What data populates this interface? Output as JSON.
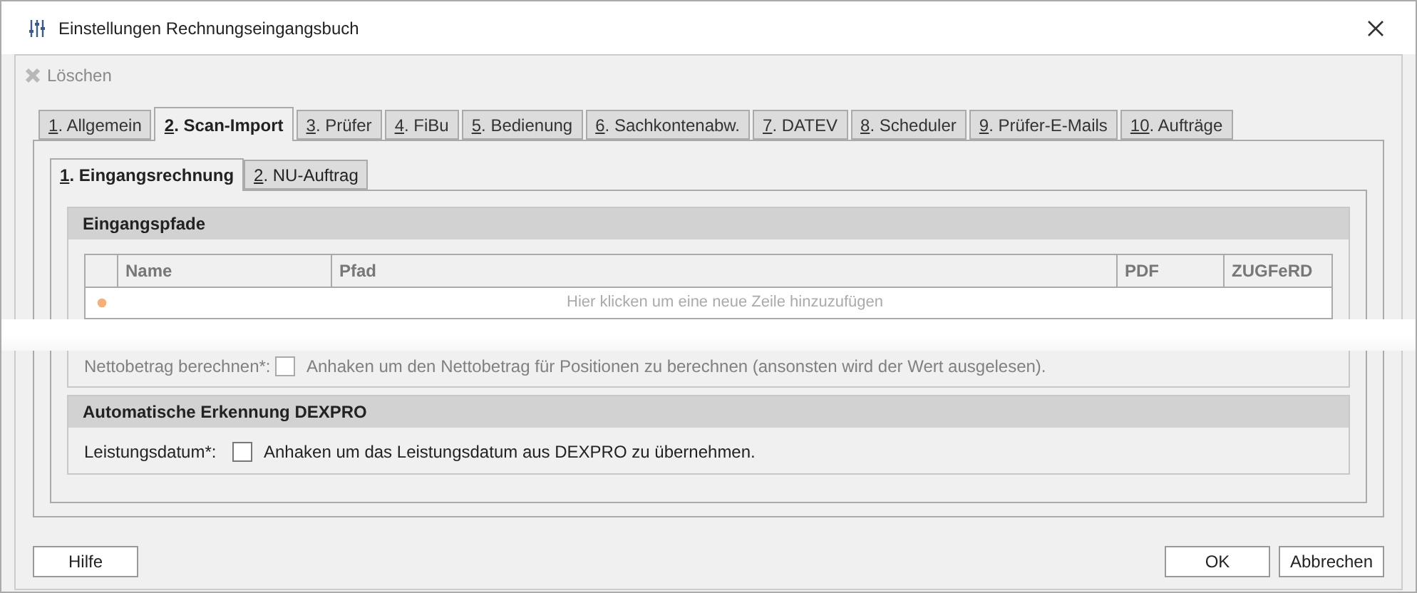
{
  "window": {
    "title": "Einstellungen Rechnungseingangsbuch"
  },
  "toolbar": [
    {
      "label": "Löschen",
      "disabled": true
    }
  ],
  "tabs": [
    {
      "label": "1. Allgemein",
      "selected": false
    },
    {
      "label": "2. Scan-Import",
      "selected": true
    },
    {
      "label": "3. Prüfer",
      "selected": false
    },
    {
      "label": "4. FiBu",
      "selected": false
    },
    {
      "label": "5. Bedienung",
      "selected": false
    },
    {
      "label": "6. Sachkontenabw.",
      "selected": false
    },
    {
      "label": "7. DATEV",
      "selected": false
    },
    {
      "label": "8. Scheduler",
      "selected": false
    },
    {
      "label": "9. Prüfer-E-Mails",
      "selected": false
    },
    {
      "label": "10. Aufträge",
      "selected": false
    }
  ],
  "subtabs": [
    {
      "label": "1. Eingangsrechnung",
      "selected": true
    },
    {
      "label": "2. NU-Auftrag",
      "selected": false
    }
  ],
  "groups": [
    {
      "title": "Eingangspfade",
      "table": {
        "columns": [
          "Name",
          "Pfad",
          "PDF",
          "ZUGFeRD"
        ],
        "new_row_hint": "Hier klicken um eine neue Zeile hinzuzufügen"
      },
      "options": [
        {
          "label": "Nettobetrag berechnen*:",
          "text": "Anhaken um den Nettobetrag für Positionen zu berechnen (ansonsten wird der Wert ausgelesen).",
          "checked": false,
          "faded": true
        }
      ]
    },
    {
      "title": "Automatische Erkennung DEXPRO",
      "options": [
        {
          "label": "Leistungsdatum*:",
          "text": "Anhaken um das Leistungsdatum aus DEXPRO zu übernehmen.",
          "checked": false,
          "faded": false
        }
      ]
    }
  ],
  "footer": {
    "left": [
      "Hilfe"
    ],
    "right": [
      "OK",
      "Abbrechen"
    ]
  }
}
